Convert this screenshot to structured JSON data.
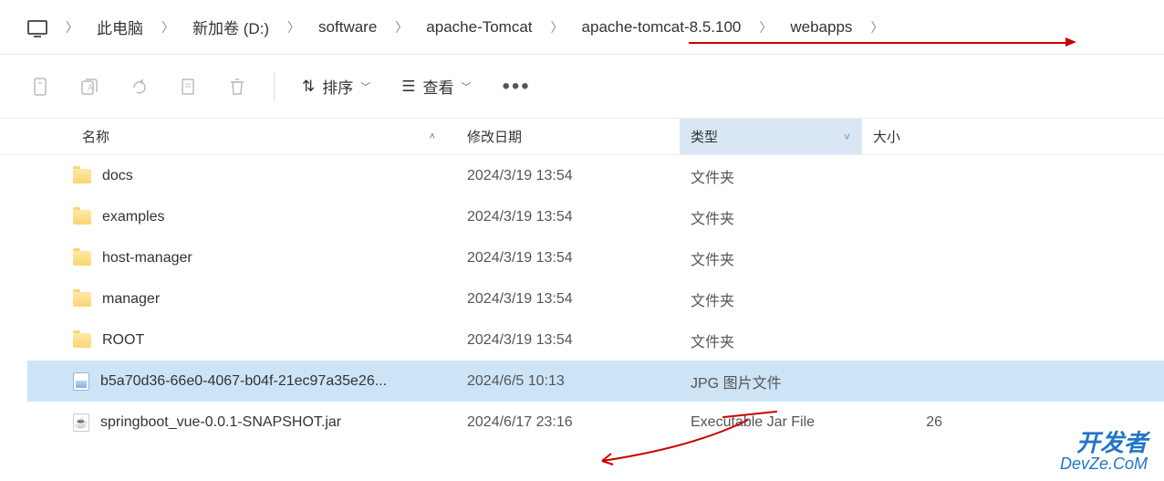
{
  "breadcrumb": {
    "items": [
      {
        "label": "",
        "icon": "pc"
      },
      {
        "label": "此电脑"
      },
      {
        "label": "新加卷 (D:)"
      },
      {
        "label": "software"
      },
      {
        "label": "apache-Tomcat"
      },
      {
        "label": "apache-tomcat-8.5.100"
      },
      {
        "label": "webapps"
      }
    ]
  },
  "toolbar": {
    "sort_label": "排序",
    "view_label": "查看"
  },
  "columns": {
    "name": "名称",
    "date": "修改日期",
    "type": "类型",
    "size": "大小"
  },
  "files": [
    {
      "name": "docs",
      "date": "2024/3/19 13:54",
      "type": "文件夹",
      "size": "",
      "icon": "folder"
    },
    {
      "name": "examples",
      "date": "2024/3/19 13:54",
      "type": "文件夹",
      "size": "",
      "icon": "folder"
    },
    {
      "name": "host-manager",
      "date": "2024/3/19 13:54",
      "type": "文件夹",
      "size": "",
      "icon": "folder"
    },
    {
      "name": "manager",
      "date": "2024/3/19 13:54",
      "type": "文件夹",
      "size": "",
      "icon": "folder"
    },
    {
      "name": "ROOT",
      "date": "2024/3/19 13:54",
      "type": "文件夹",
      "size": "",
      "icon": "folder"
    },
    {
      "name": "b5a70d36-66e0-4067-b04f-21ec97a35e26...",
      "date": "2024/6/5 10:13",
      "type": "JPG 图片文件",
      "size": "",
      "icon": "jpg"
    },
    {
      "name": "springboot_vue-0.0.1-SNAPSHOT.jar",
      "date": "2024/6/17 23:16",
      "type": "Executable Jar File",
      "size": "26",
      "icon": "jar"
    }
  ],
  "watermark": {
    "line1": "开发者",
    "line2": "DevZe.CoM"
  }
}
